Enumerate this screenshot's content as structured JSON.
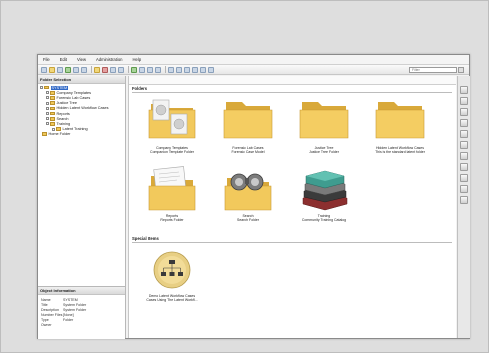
{
  "menu": [
    "File",
    "Edit",
    "View",
    "Administration",
    "Help"
  ],
  "search": {
    "placeholder": "Filter"
  },
  "left_pane": {
    "title": "Folder Selection",
    "tree": [
      {
        "label": "SYSTEM",
        "depth": 0,
        "selected": true
      },
      {
        "label": "Company Templates",
        "depth": 1
      },
      {
        "label": "Forensic Lab Cases",
        "depth": 1
      },
      {
        "label": "Justice Tree",
        "depth": 1
      },
      {
        "label": "Hidden Latent Workflow Cases",
        "depth": 1
      },
      {
        "label": "Reports",
        "depth": 1
      },
      {
        "label": "Search",
        "depth": 1
      },
      {
        "label": "Training",
        "depth": 1
      },
      {
        "label": "Latent Training",
        "depth": 2
      },
      {
        "label": "Home Folder",
        "depth": 0
      }
    ]
  },
  "object_info": {
    "title": "Object Information",
    "rows": [
      {
        "key": "Name",
        "value": "SYSTEM"
      },
      {
        "key": "Title",
        "value": "System Folder"
      },
      {
        "key": "Description",
        "value": "System Folder"
      },
      {
        "key": "Number Files",
        "value": "[None]"
      },
      {
        "key": "Type",
        "value": "Folder"
      },
      {
        "key": "Owner",
        "value": ""
      }
    ]
  },
  "main": {
    "folders_title": "Folders",
    "special_title": "Special Items",
    "folders": [
      {
        "name": "Company Templates",
        "desc": "Companion Template Folder",
        "icon": "templates-folder-icon"
      },
      {
        "name": "Forensic Lab Cases",
        "desc": "Forensic Case Model",
        "icon": "folder-icon"
      },
      {
        "name": "Justice Tree",
        "desc": "Justice Tree Folder",
        "icon": "folder-icon"
      },
      {
        "name": "Hidden Latent Workflow Cases",
        "desc": "This is the standard latent folder",
        "icon": "folder-icon"
      },
      {
        "name": "Reports",
        "desc": "Reports Folder",
        "icon": "reports-folder-icon"
      },
      {
        "name": "Search",
        "desc": "Search Folder",
        "icon": "search-binoculars-icon"
      },
      {
        "name": "Training",
        "desc": "Community Training Catalog",
        "icon": "books-icon"
      }
    ],
    "special_items": [
      {
        "name": "Demo Latent Workflow Cases",
        "desc": "Cases Using The Latent Workfl...",
        "icon": "workflow-circle-icon"
      }
    ]
  },
  "colors": {
    "folder": "#f2c95c",
    "folder_dark": "#d9a93a",
    "selection": "#3169c6"
  }
}
